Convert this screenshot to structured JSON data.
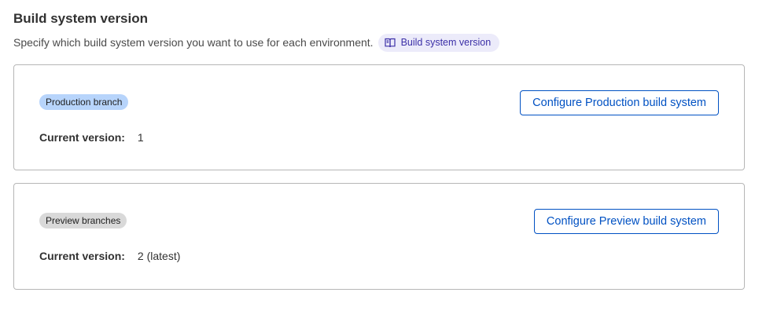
{
  "header": {
    "title": "Build system version",
    "description": "Specify which build system version you want to use for each environment.",
    "doc_link": {
      "label": "Build system version",
      "icon": "book-icon"
    }
  },
  "environments": [
    {
      "badge": "Production branch",
      "badge_color": "#b7d4fb",
      "version_label": "Current version:",
      "version_value": "1",
      "button_label": "Configure Production build system"
    },
    {
      "badge": "Preview branches",
      "badge_color": "#d9d9d9",
      "version_label": "Current version:",
      "version_value": "2 (latest)",
      "button_label": "Configure Preview build system"
    }
  ],
  "colors": {
    "accent": "#0051c3",
    "doc_link_bg": "#ecebfa",
    "doc_link_text": "#3b2fa7",
    "border": "#b6b6b6"
  }
}
